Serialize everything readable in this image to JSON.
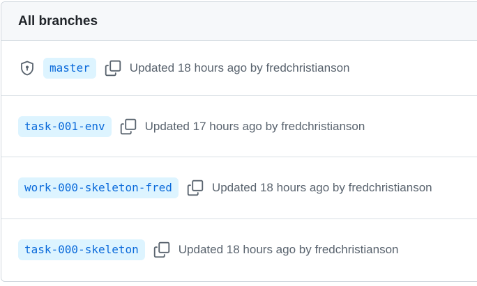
{
  "header": {
    "title": "All branches"
  },
  "branches": [
    {
      "name": "master",
      "protected": true,
      "icon": "shield-lock-icon",
      "updated_prefix": "Updated",
      "updated_time": "18 hours ago",
      "by_label": "by",
      "author": "fredchristianson"
    },
    {
      "name": "task-001-env",
      "protected": false,
      "updated_prefix": "Updated",
      "updated_time": "17 hours ago",
      "by_label": "by",
      "author": "fredchristianson"
    },
    {
      "name": "work-000-skeleton-fred",
      "protected": false,
      "updated_prefix": "Updated",
      "updated_time": "18 hours ago",
      "by_label": "by",
      "author": "fredchristianson"
    },
    {
      "name": "task-000-skeleton",
      "protected": false,
      "updated_prefix": "Updated",
      "updated_time": "18 hours ago",
      "by_label": "by",
      "author": "fredchristianson"
    }
  ],
  "icons": {
    "copy": "copy-icon",
    "shield": "shield-lock-icon"
  },
  "colors": {
    "branch_text": "#0969da",
    "branch_bg": "#ddf4ff",
    "muted_text": "#59636e",
    "header_bg": "#f6f8fa",
    "border": "#d0d7de"
  }
}
